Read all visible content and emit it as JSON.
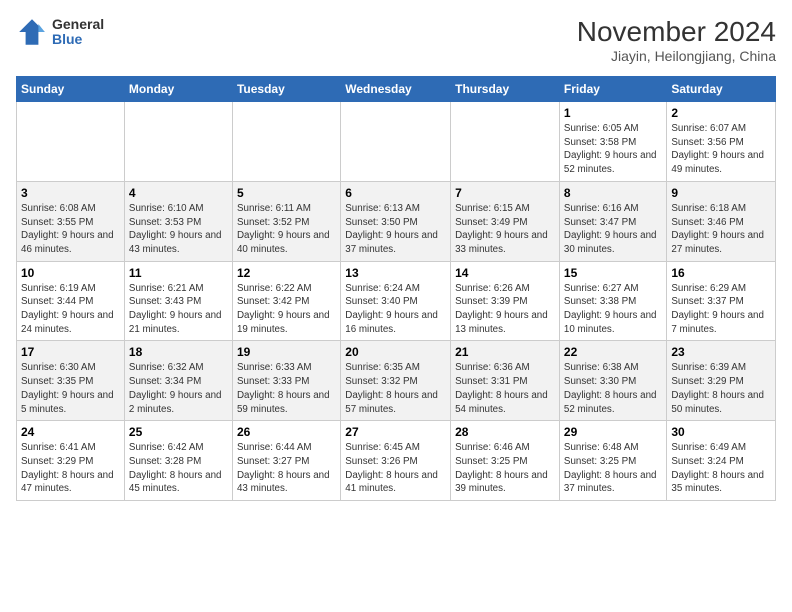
{
  "logo": {
    "general": "General",
    "blue": "Blue"
  },
  "title": {
    "month_year": "November 2024",
    "location": "Jiayin, Heilongjiang, China"
  },
  "headers": [
    "Sunday",
    "Monday",
    "Tuesday",
    "Wednesday",
    "Thursday",
    "Friday",
    "Saturday"
  ],
  "weeks": [
    [
      {
        "day": "",
        "info": ""
      },
      {
        "day": "",
        "info": ""
      },
      {
        "day": "",
        "info": ""
      },
      {
        "day": "",
        "info": ""
      },
      {
        "day": "",
        "info": ""
      },
      {
        "day": "1",
        "info": "Sunrise: 6:05 AM\nSunset: 3:58 PM\nDaylight: 9 hours\nand 52 minutes."
      },
      {
        "day": "2",
        "info": "Sunrise: 6:07 AM\nSunset: 3:56 PM\nDaylight: 9 hours\nand 49 minutes."
      }
    ],
    [
      {
        "day": "3",
        "info": "Sunrise: 6:08 AM\nSunset: 3:55 PM\nDaylight: 9 hours\nand 46 minutes."
      },
      {
        "day": "4",
        "info": "Sunrise: 6:10 AM\nSunset: 3:53 PM\nDaylight: 9 hours\nand 43 minutes."
      },
      {
        "day": "5",
        "info": "Sunrise: 6:11 AM\nSunset: 3:52 PM\nDaylight: 9 hours\nand 40 minutes."
      },
      {
        "day": "6",
        "info": "Sunrise: 6:13 AM\nSunset: 3:50 PM\nDaylight: 9 hours\nand 37 minutes."
      },
      {
        "day": "7",
        "info": "Sunrise: 6:15 AM\nSunset: 3:49 PM\nDaylight: 9 hours\nand 33 minutes."
      },
      {
        "day": "8",
        "info": "Sunrise: 6:16 AM\nSunset: 3:47 PM\nDaylight: 9 hours\nand 30 minutes."
      },
      {
        "day": "9",
        "info": "Sunrise: 6:18 AM\nSunset: 3:46 PM\nDaylight: 9 hours\nand 27 minutes."
      }
    ],
    [
      {
        "day": "10",
        "info": "Sunrise: 6:19 AM\nSunset: 3:44 PM\nDaylight: 9 hours\nand 24 minutes."
      },
      {
        "day": "11",
        "info": "Sunrise: 6:21 AM\nSunset: 3:43 PM\nDaylight: 9 hours\nand 21 minutes."
      },
      {
        "day": "12",
        "info": "Sunrise: 6:22 AM\nSunset: 3:42 PM\nDaylight: 9 hours\nand 19 minutes."
      },
      {
        "day": "13",
        "info": "Sunrise: 6:24 AM\nSunset: 3:40 PM\nDaylight: 9 hours\nand 16 minutes."
      },
      {
        "day": "14",
        "info": "Sunrise: 6:26 AM\nSunset: 3:39 PM\nDaylight: 9 hours\nand 13 minutes."
      },
      {
        "day": "15",
        "info": "Sunrise: 6:27 AM\nSunset: 3:38 PM\nDaylight: 9 hours\nand 10 minutes."
      },
      {
        "day": "16",
        "info": "Sunrise: 6:29 AM\nSunset: 3:37 PM\nDaylight: 9 hours\nand 7 minutes."
      }
    ],
    [
      {
        "day": "17",
        "info": "Sunrise: 6:30 AM\nSunset: 3:35 PM\nDaylight: 9 hours\nand 5 minutes."
      },
      {
        "day": "18",
        "info": "Sunrise: 6:32 AM\nSunset: 3:34 PM\nDaylight: 9 hours\nand 2 minutes."
      },
      {
        "day": "19",
        "info": "Sunrise: 6:33 AM\nSunset: 3:33 PM\nDaylight: 8 hours\nand 59 minutes."
      },
      {
        "day": "20",
        "info": "Sunrise: 6:35 AM\nSunset: 3:32 PM\nDaylight: 8 hours\nand 57 minutes."
      },
      {
        "day": "21",
        "info": "Sunrise: 6:36 AM\nSunset: 3:31 PM\nDaylight: 8 hours\nand 54 minutes."
      },
      {
        "day": "22",
        "info": "Sunrise: 6:38 AM\nSunset: 3:30 PM\nDaylight: 8 hours\nand 52 minutes."
      },
      {
        "day": "23",
        "info": "Sunrise: 6:39 AM\nSunset: 3:29 PM\nDaylight: 8 hours\nand 50 minutes."
      }
    ],
    [
      {
        "day": "24",
        "info": "Sunrise: 6:41 AM\nSunset: 3:29 PM\nDaylight: 8 hours\nand 47 minutes."
      },
      {
        "day": "25",
        "info": "Sunrise: 6:42 AM\nSunset: 3:28 PM\nDaylight: 8 hours\nand 45 minutes."
      },
      {
        "day": "26",
        "info": "Sunrise: 6:44 AM\nSunset: 3:27 PM\nDaylight: 8 hours\nand 43 minutes."
      },
      {
        "day": "27",
        "info": "Sunrise: 6:45 AM\nSunset: 3:26 PM\nDaylight: 8 hours\nand 41 minutes."
      },
      {
        "day": "28",
        "info": "Sunrise: 6:46 AM\nSunset: 3:25 PM\nDaylight: 8 hours\nand 39 minutes."
      },
      {
        "day": "29",
        "info": "Sunrise: 6:48 AM\nSunset: 3:25 PM\nDaylight: 8 hours\nand 37 minutes."
      },
      {
        "day": "30",
        "info": "Sunrise: 6:49 AM\nSunset: 3:24 PM\nDaylight: 8 hours\nand 35 minutes."
      }
    ]
  ]
}
